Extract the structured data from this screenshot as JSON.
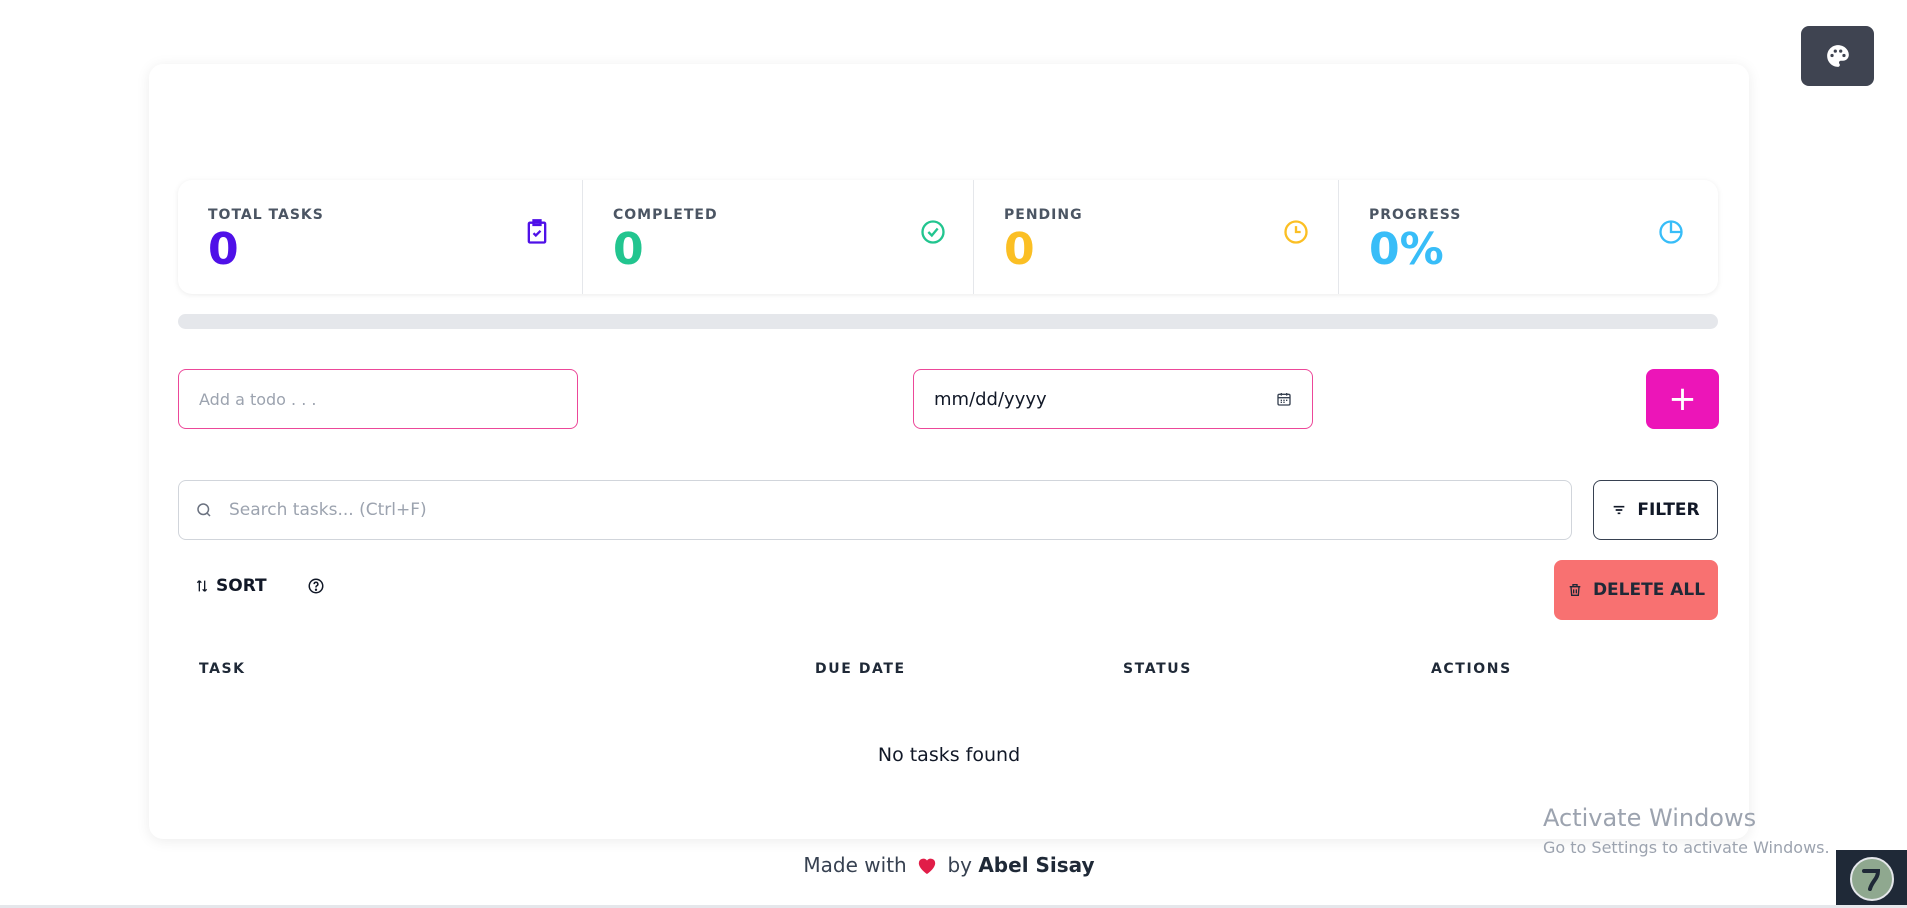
{
  "stats": [
    {
      "title": "TOTAL TASKS",
      "value": "0",
      "color": "#4f10e8",
      "icon": "clipboard-check-icon"
    },
    {
      "title": "COMPLETED",
      "value": "0",
      "color": "#22c58f",
      "icon": "check-circle-icon"
    },
    {
      "title": "PENDING",
      "value": "0",
      "color": "#fbbf24",
      "icon": "clock-icon"
    },
    {
      "title": "PROGRESS",
      "value": "0%",
      "color": "#38bdf8",
      "icon": "pie-chart-icon"
    }
  ],
  "progress_percent": 0,
  "form": {
    "todo_placeholder": "Add a todo . . .",
    "date_placeholder": "mm/dd/yyyy",
    "add_label": "+"
  },
  "search": {
    "placeholder": "Search tasks... (Ctrl+F)"
  },
  "toolbar": {
    "filter_label": "FILTER",
    "sort_label": "SORT",
    "delete_all_label": "DELETE ALL"
  },
  "table": {
    "headers": [
      "TASK",
      "DUE DATE",
      "STATUS",
      "ACTIONS"
    ],
    "empty_message": "No tasks found"
  },
  "footer": {
    "made_with": "Made with",
    "by": "by",
    "author": "Abel Sisay"
  },
  "watermark": {
    "title": "Activate Windows",
    "subtitle": "Go to Settings to activate Windows."
  },
  "colors": {
    "accent": "#ec15b8",
    "danger": "#f87171",
    "theme_button": "#3f4451"
  }
}
